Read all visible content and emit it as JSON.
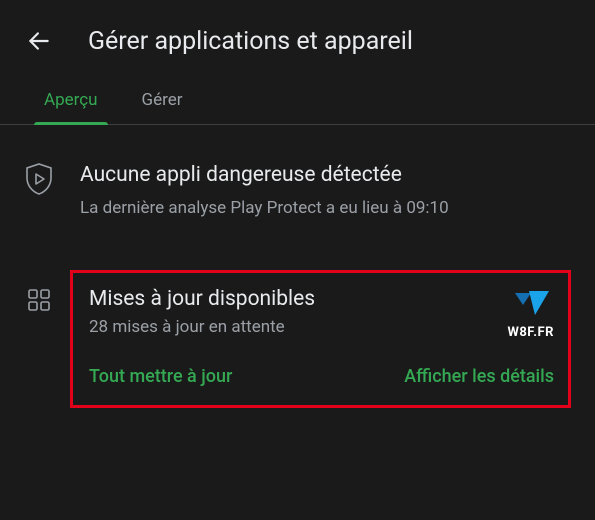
{
  "header": {
    "title": "Gérer applications et appareil"
  },
  "tabs": [
    {
      "label": "Aperçu",
      "active": true
    },
    {
      "label": "Gérer",
      "active": false
    }
  ],
  "protect": {
    "title": "Aucune appli dangereuse détectée",
    "subtitle": "La dernière analyse Play Protect a eu lieu à 09:10"
  },
  "updates": {
    "title": "Mises à jour disponibles",
    "subtitle": "28 mises à jour en attente",
    "logo_text": "W8F.FR",
    "action_update_all": "Tout mettre à jour",
    "action_details": "Afficher les détails"
  }
}
